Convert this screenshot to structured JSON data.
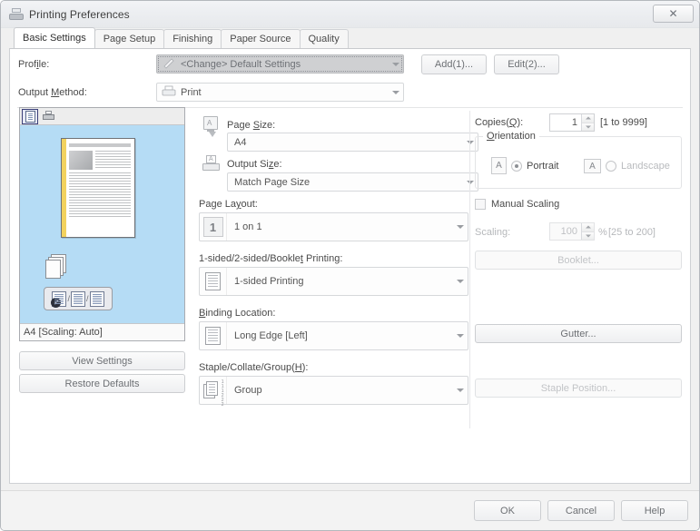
{
  "window": {
    "title": "Printing Preferences",
    "title_icon": "printer-icon",
    "close_label": "✕"
  },
  "tabs": [
    {
      "label": "Basic Settings",
      "active": true
    },
    {
      "label": "Page Setup",
      "active": false
    },
    {
      "label": "Finishing",
      "active": false
    },
    {
      "label": "Paper Source",
      "active": false
    },
    {
      "label": "Quality",
      "active": false
    }
  ],
  "top": {
    "profile_label": "Profile:",
    "profile_value": "<Change> Default Settings",
    "profile_icon": "pencil-icon",
    "output_method_label": "Output Method:",
    "output_method_value": "Print",
    "output_method_icon": "printer-icon",
    "add_button": "Add(1)...",
    "edit_button": "Edit(2)..."
  },
  "preview": {
    "toolbar": [
      {
        "name": "document-preview-toggle",
        "icon": "document-icon",
        "active": true
      },
      {
        "name": "printer-preview-toggle",
        "icon": "printer-icon",
        "active": false
      }
    ],
    "status": "A4 [Scaling: Auto]",
    "mode_bar": "/ /",
    "view_settings_button": "View Settings",
    "restore_defaults_button": "Restore Defaults"
  },
  "center": {
    "page_size_label": "Page Size:",
    "page_size_value": "A4",
    "page_size_icon": "screen-a-icon",
    "output_size_label": "Output Size:",
    "output_size_value": "Match Page Size",
    "output_size_icon": "printer-a-icon",
    "page_layout_label": "Page Layout:",
    "page_layout_value": "1 on 1",
    "page_layout_icon": "1-up-icon",
    "sided_label": "1-sided/2-sided/Booklet Printing:",
    "sided_value": "1-sided Printing",
    "sided_icon": "single-sheet-icon",
    "binding_label": "Binding Location:",
    "binding_value": "Long Edge [Left]",
    "binding_icon": "sheet-icon",
    "staple_label": "Staple/Collate/Group(H):",
    "staple_value": "Group",
    "staple_icon": "group-sheets-icon"
  },
  "right": {
    "copies_label": "Copies(Q):",
    "copies_value": "1",
    "copies_range": "[1 to 9999]",
    "orientation_label": "Orientation",
    "portrait_label": "Portrait",
    "portrait_selected": true,
    "landscape_label": "Landscape",
    "landscape_selected": false,
    "orientation_glyph": "A",
    "manual_scaling_label": "Manual Scaling",
    "manual_scaling_checked": false,
    "scaling_label": "Scaling:",
    "scaling_value": "100",
    "scaling_unit": "%",
    "scaling_range": "[25 to 200]",
    "booklet_button": "Booklet...",
    "booklet_disabled": true,
    "gutter_button": "Gutter...",
    "gutter_disabled": false,
    "staple_position_button": "Staple Position...",
    "staple_position_disabled": true
  },
  "footer": {
    "ok_button": "OK",
    "cancel_button": "Cancel",
    "help_button": "Help"
  },
  "colors": {
    "preview_background": "#b5dcf5",
    "binding_edge": "#f2d25e",
    "active_toggle_border": "#3b3f78"
  }
}
